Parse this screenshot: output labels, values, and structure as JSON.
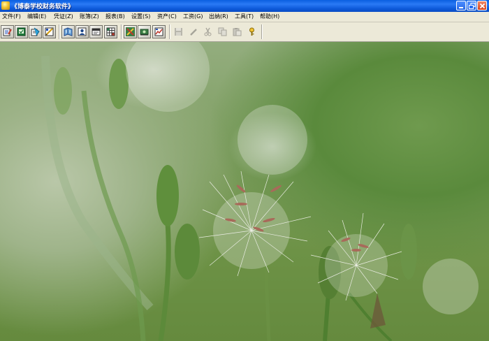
{
  "window": {
    "title": "《博泰学校财务软件》"
  },
  "menu": [
    {
      "label": "文件(F)"
    },
    {
      "label": "编辑(E)"
    },
    {
      "label": "凭证(Z)"
    },
    {
      "label": "账簿(Z)"
    },
    {
      "label": "报表(B)"
    },
    {
      "label": "设置(S)"
    },
    {
      "label": "资产(C)"
    },
    {
      "label": "工资(G)"
    },
    {
      "label": "出纳(R)"
    },
    {
      "label": "工具(T)"
    },
    {
      "label": "帮助(H)"
    }
  ],
  "toolbar": {
    "groups": [
      [
        "voucher-entry-icon",
        "voucher-review-icon",
        "voucher-post-icon",
        "voucher-edit-icon"
      ],
      [
        "ledger-book-icon",
        "user-card-icon",
        "report-icon",
        "table-grid-icon"
      ],
      [
        "tools-icon",
        "cash-icon",
        "chart-report-icon"
      ],
      [
        "save-icon",
        "pen-icon",
        "cut-icon",
        "copy-icon",
        "paste-icon",
        "help-key-icon"
      ]
    ]
  },
  "colors": {
    "titlebar": "#0a5fe0",
    "menubar": "#ece9d8",
    "background_green": "#6d9246"
  }
}
